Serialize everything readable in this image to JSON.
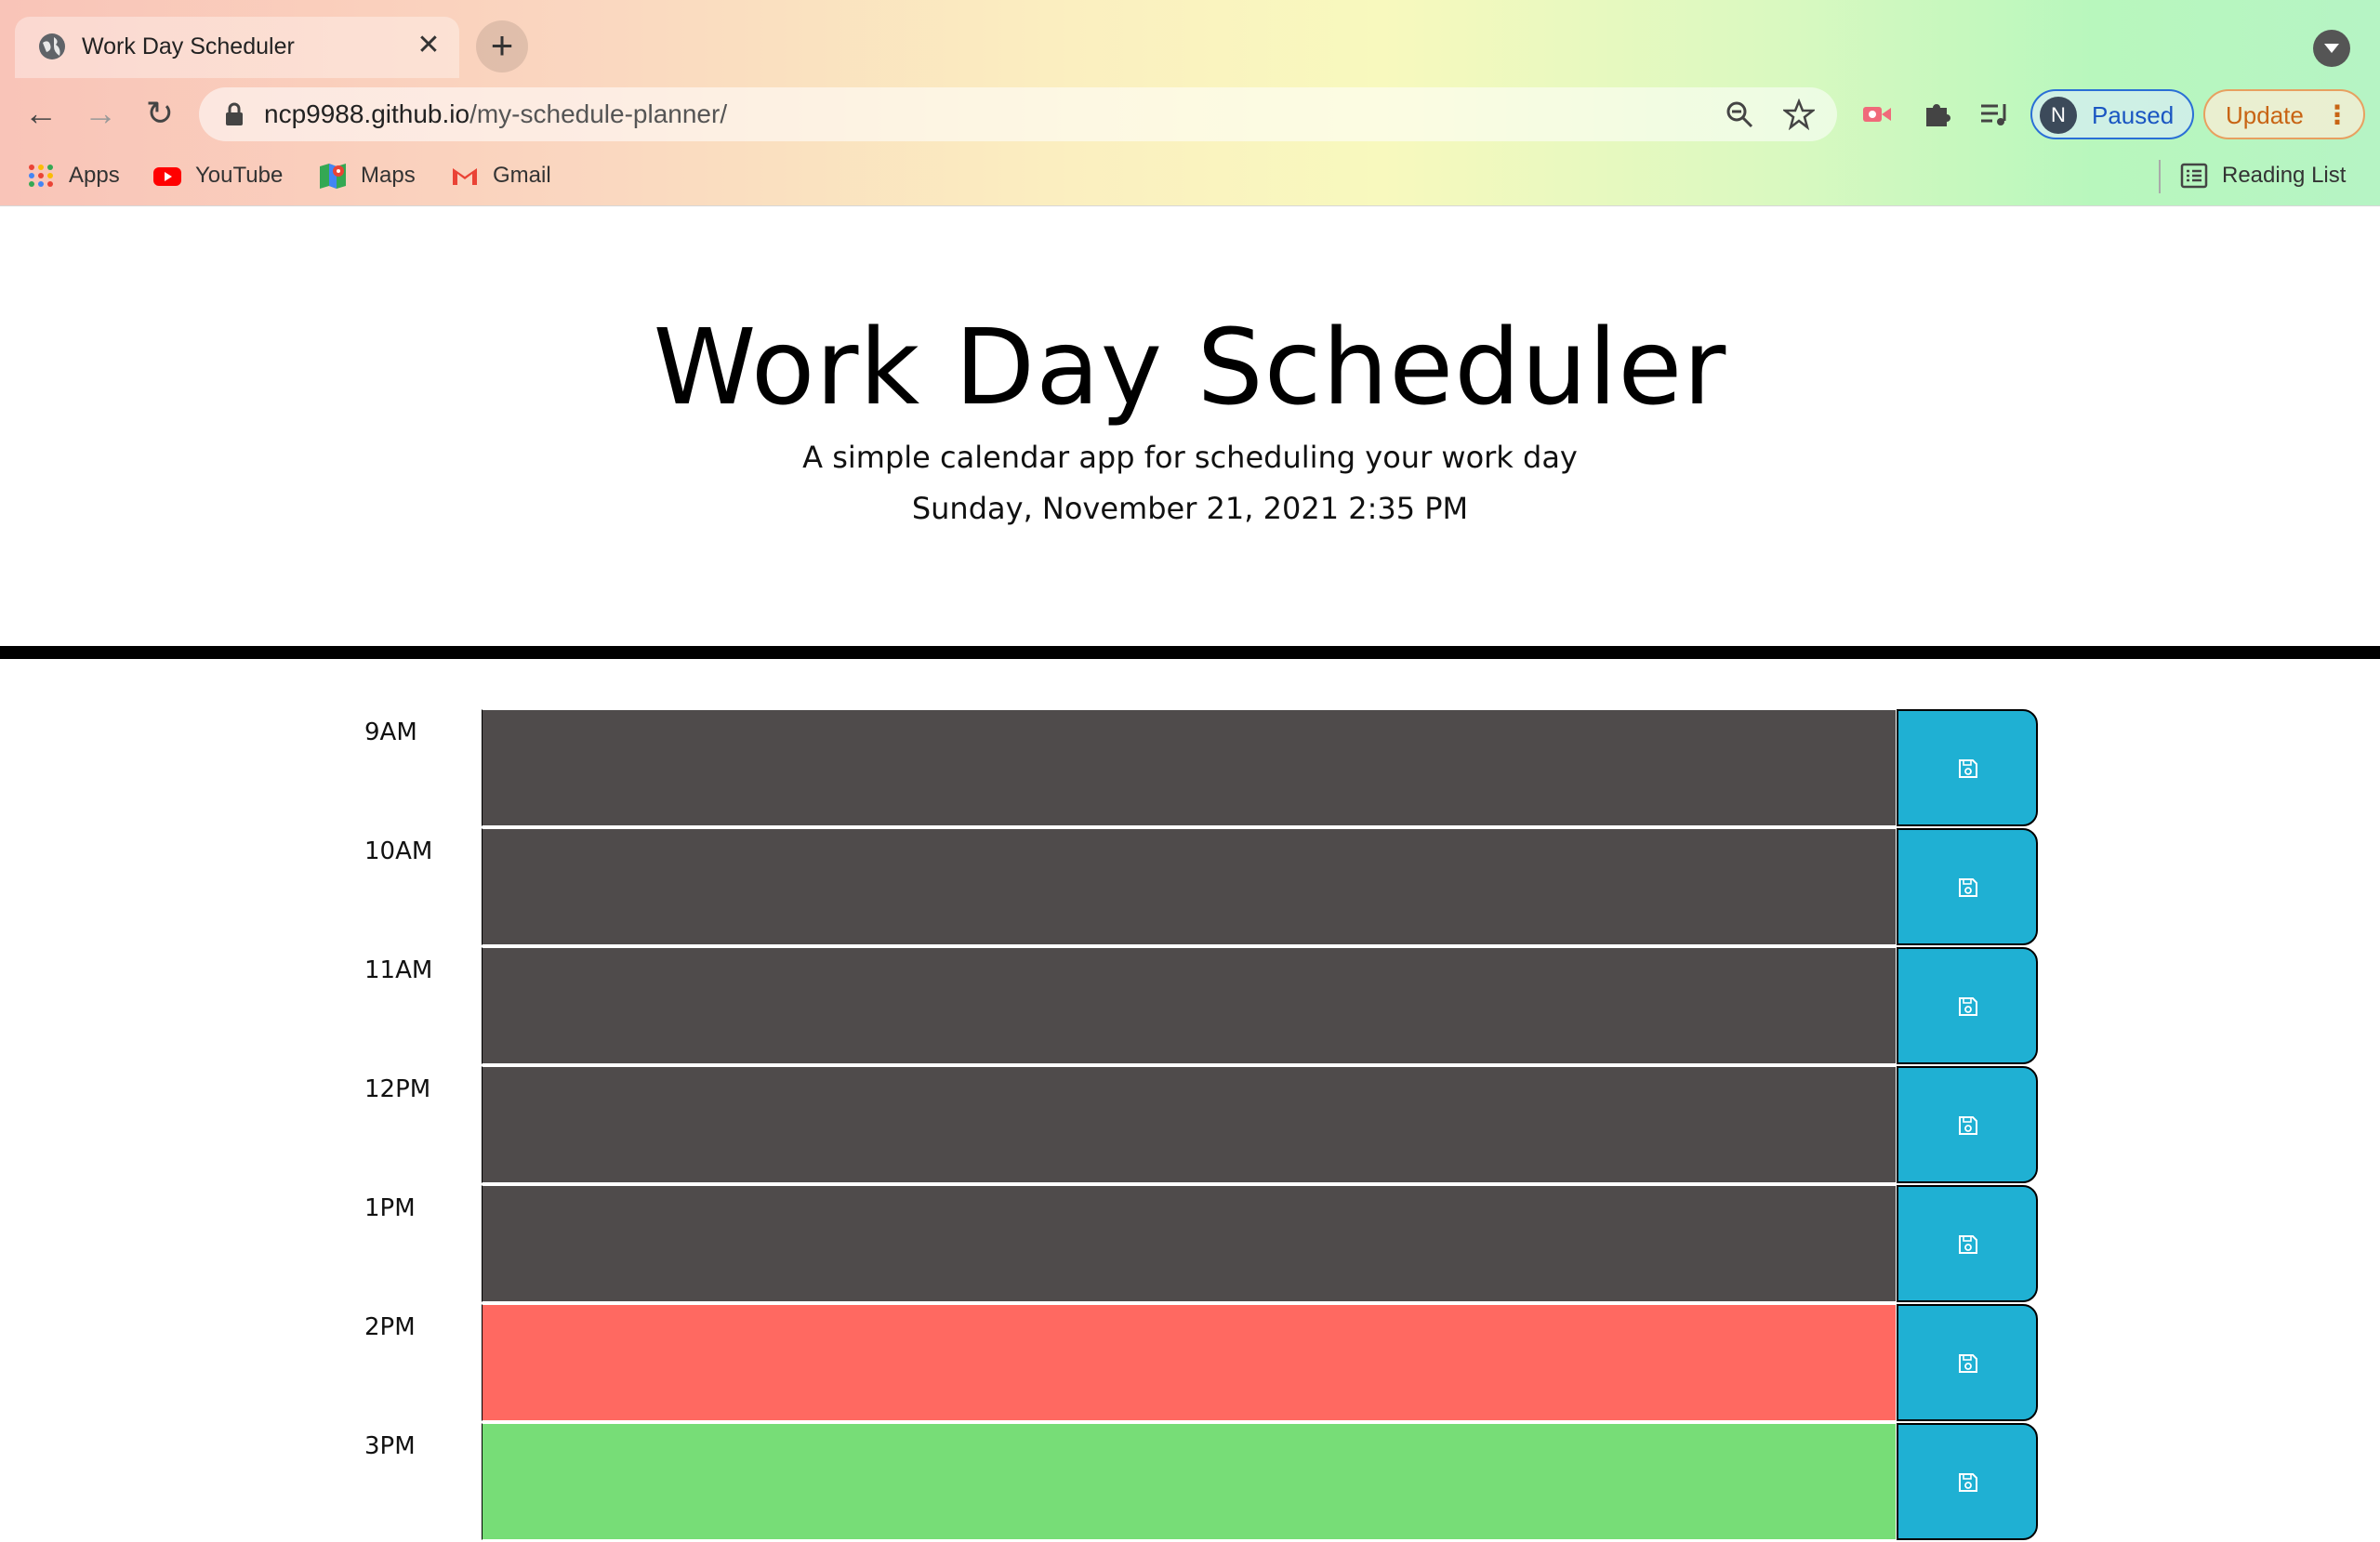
{
  "browser": {
    "tab_title": "Work Day Scheduler",
    "url_domain": "ncp9988.github.io",
    "url_path": "/my-schedule-planner/",
    "profile_initial": "N",
    "profile_label": "Paused",
    "update_label": "Update",
    "bookmarks": [
      {
        "label": "Apps",
        "icon": "apps-grid-icon"
      },
      {
        "label": "YouTube",
        "icon": "youtube-icon"
      },
      {
        "label": "Maps",
        "icon": "maps-icon"
      },
      {
        "label": "Gmail",
        "icon": "gmail-icon"
      }
    ],
    "reading_list_label": "Reading List"
  },
  "header": {
    "title": "Work Day Scheduler",
    "subtitle": "A simple calendar app for scheduling your work day",
    "current_datetime": "Sunday, November 21, 2021 2:35 PM"
  },
  "schedule": {
    "rows": [
      {
        "hour": "9AM",
        "state": "past",
        "text": ""
      },
      {
        "hour": "10AM",
        "state": "past",
        "text": ""
      },
      {
        "hour": "11AM",
        "state": "past",
        "text": ""
      },
      {
        "hour": "12PM",
        "state": "past",
        "text": ""
      },
      {
        "hour": "1PM",
        "state": "past",
        "text": ""
      },
      {
        "hour": "2PM",
        "state": "present",
        "text": ""
      },
      {
        "hour": "3PM",
        "state": "future",
        "text": ""
      }
    ]
  },
  "colors": {
    "past": "#4f4b4b",
    "present": "#ff6961",
    "future": "#77dd77",
    "save_button": "#1fb0d3"
  }
}
